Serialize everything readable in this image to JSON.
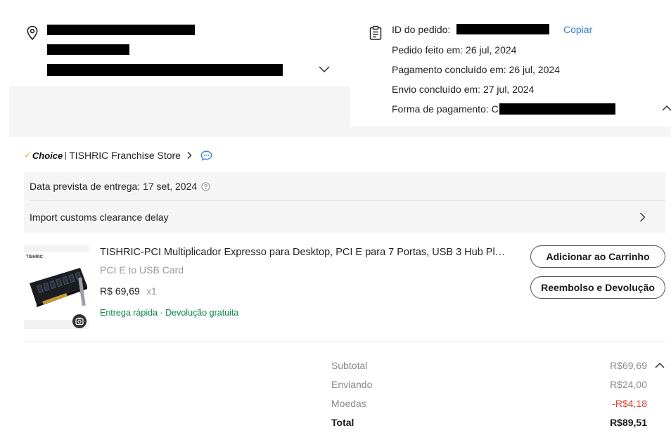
{
  "address": {
    "expand_icon": "chevron-down-icon",
    "location_icon": "location-pin-icon"
  },
  "order": {
    "id_label": "ID do pedido:",
    "copy_label": "Copiar",
    "placed_label": "Pedido feito em: 26 jul, 2024",
    "payment_done_label": "Pagamento concluído em: 26 jul, 2024",
    "shipped_label": "Envio concluído em: 27 jul, 2024",
    "payment_method_label": "Forma de pagamento: C",
    "collapse_icon": "chevron-up-icon",
    "clipboard_icon": "clipboard-icon"
  },
  "store": {
    "choice_check": "✓",
    "choice_label": "Choice",
    "name": "TISHRIC Franchise Store",
    "chat_icon": "chat-bubble-icon"
  },
  "delivery": {
    "estimate_label": "Data prevista de entrega: 17 set, 2024",
    "customs_label": "Import customs clearance delay"
  },
  "product": {
    "brand": "TISHRIC",
    "title": "TISHRIC-PCI Multiplicador Expresso para Desktop, PCI E para 7 Portas, USB 3 Hub Placa PCIe",
    "variant": "PCI E to USB Card",
    "price": "R$ 69,69",
    "qty": "x1",
    "tags": "Entrega rápida · Devolução gratuita",
    "add_to_cart": "Adicionar ao Carrinho",
    "refund": "Reembolso e Devolução"
  },
  "summary": {
    "subtotal_label": "Subtotal",
    "subtotal_value": "R$69,69",
    "shipping_label": "Enviando",
    "shipping_value": "R$24,00",
    "coins_label": "Moedas",
    "coins_value": "-R$4,18",
    "total_label": "Total",
    "total_value": "R$89,51"
  },
  "colors": {
    "link": "#2e7cf6",
    "green": "#0a8a4a",
    "discount_red": "#e8392b",
    "choice_orange": "#fda42d"
  }
}
